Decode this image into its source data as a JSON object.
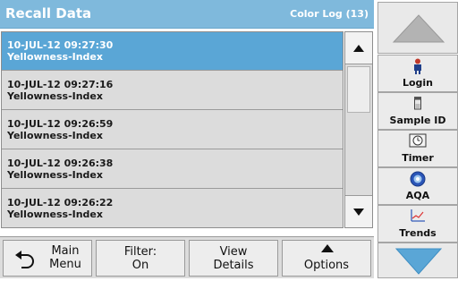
{
  "header": {
    "title": "Recall Data",
    "subtitle": "Color Log (13)"
  },
  "list": {
    "items": [
      {
        "datetime": "10-JUL-12  09:27:30",
        "parameter": "Yellowness-Index",
        "selected": true
      },
      {
        "datetime": "10-JUL-12  09:27:16",
        "parameter": "Yellowness-Index",
        "selected": false
      },
      {
        "datetime": "10-JUL-12  09:26:59",
        "parameter": "Yellowness-Index",
        "selected": false
      },
      {
        "datetime": "10-JUL-12  09:26:38",
        "parameter": "Yellowness-Index",
        "selected": false
      },
      {
        "datetime": "10-JUL-12  09:26:22",
        "parameter": "Yellowness-Index",
        "selected": false
      }
    ]
  },
  "sidebar": {
    "login": "Login",
    "sample_id": "Sample ID",
    "timer": "Timer",
    "aqa": "AQA",
    "trends": "Trends"
  },
  "bottom": {
    "main_menu_line1": "Main",
    "main_menu_line2": "Menu",
    "filter_line1": "Filter:",
    "filter_line2": "On",
    "view_line1": "View",
    "view_line2": "Details",
    "options": "Options"
  },
  "colors": {
    "header": "#7fb9dc",
    "selected_row": "#5aa6d6",
    "nav_arrow_up": "#b3b3b3",
    "nav_arrow_down": "#5aa6d6"
  },
  "icons": {
    "back": "back-arrow-icon",
    "login": "person-icon",
    "sample_id": "sample-vial-icon",
    "timer": "timer-icon",
    "aqa": "aqa-icon",
    "trends": "trend-chart-icon"
  }
}
